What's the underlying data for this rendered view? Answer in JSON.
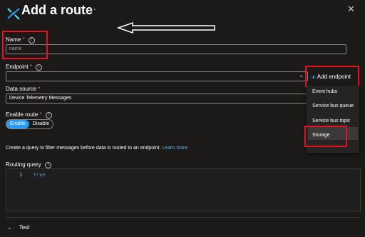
{
  "header": {
    "title": "Add a route",
    "more_label": "···",
    "close_label": "✕"
  },
  "form": {
    "name": {
      "label": "Name",
      "required_mark": "*",
      "placeholder": "name",
      "value": ""
    },
    "endpoint": {
      "label": "Endpoint",
      "required_mark": "*",
      "value": ""
    },
    "add_endpoint": {
      "label": "Add endpoint",
      "icon": "plus-icon"
    },
    "data_source": {
      "label": "Data source",
      "required_mark": "*",
      "value": "Device Telemetry Messages"
    },
    "enable_route": {
      "label": "Enable route",
      "required_mark": "*",
      "options": [
        "Enable",
        "Disable"
      ],
      "selected": "Enable"
    },
    "query_help": {
      "text": "Create a query to filter messages before data is routed to an endpoint.",
      "link": "Learn more"
    },
    "routing_query": {
      "label": "Routing query",
      "line_number": "1",
      "code": "true"
    },
    "test_section": {
      "label": "Test"
    }
  },
  "endpoint_menu": {
    "items": [
      "Event hubs",
      "Service bus queue",
      "Service bus topic",
      "Storage"
    ],
    "selected": "Storage"
  },
  "colors": {
    "accent": "#2899f5",
    "annotation": "#e81123",
    "background": "#1b1a19"
  }
}
